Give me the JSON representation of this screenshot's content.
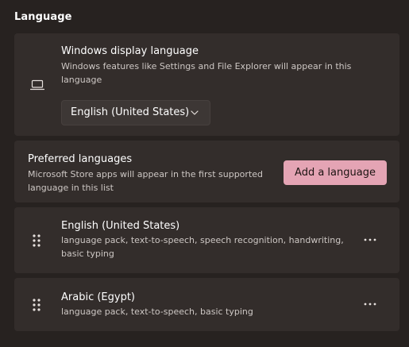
{
  "section": {
    "title": "Language"
  },
  "display_language": {
    "icon": "laptop-icon",
    "title": "Windows display language",
    "description": "Windows features like Settings and File Explorer will appear in this language",
    "selected": "English (United States)"
  },
  "preferred_languages": {
    "title": "Preferred languages",
    "description": "Microsoft Store apps will appear in the first supported language in this list",
    "add_button_label": "Add a language",
    "accent_color": "#e4a4b4"
  },
  "languages": [
    {
      "name": "English (United States)",
      "features": "language pack, text-to-speech, speech recognition, handwriting, basic typing"
    },
    {
      "name": "Arabic (Egypt)",
      "features": "language pack, text-to-speech, basic typing"
    }
  ],
  "colors": {
    "background": "#272220",
    "card": "#332d2b",
    "dropdown": "#3d3735"
  }
}
